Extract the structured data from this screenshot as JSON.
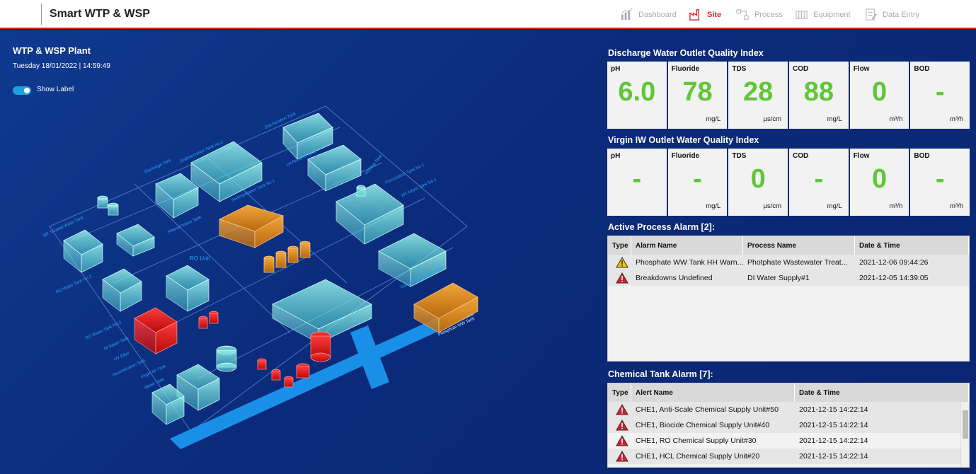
{
  "app": {
    "title": "Smart WTP & WSP"
  },
  "nav": [
    {
      "label": "Dashboard",
      "icon": "chart-icon",
      "active": false
    },
    {
      "label": "Site",
      "icon": "factory-icon",
      "active": true
    },
    {
      "label": "Process",
      "icon": "process-icon",
      "active": false
    },
    {
      "label": "Equipment",
      "icon": "equipment-icon",
      "active": false
    },
    {
      "label": "Data Entry",
      "icon": "data-entry-icon",
      "active": false
    }
  ],
  "plant": {
    "title": "WTP & WSP Plant",
    "datetime": "Tuesday 18/01/2022 | 14:59:49",
    "show_label": "Show Label",
    "show_label_on": true,
    "labels": {
      "t1": "2nd Aeration Tank",
      "t2": "Sedimentation Tank No.2",
      "t3": "1st Aeration Tank",
      "t4": "Discharge Tank",
      "t5": "Holding Tank",
      "t6": "Flocculation Tank No.1",
      "t7": "pH Adjust Tank No.1",
      "t8": "MF Treated Water Tank",
      "t9": "RO Unit",
      "t10": "RO Water Tank No.1",
      "t11": "General Batch WW Tank",
      "t12": "RO Water Tank No.2",
      "t13": "DI Water Tank",
      "t14": "UV Filter",
      "t15": "Neutralization Tank",
      "t16": "Virgin IW Tank",
      "t17": "Water Tank",
      "t18": "Phosphate WW Tank",
      "t19": "Filtered Water Tank",
      "t20": "Sedimentation Tank No.1"
    }
  },
  "discharge": {
    "title": "Discharge Water Outlet Quality Index",
    "items": [
      {
        "label": "pH",
        "value": "6.0",
        "unit": ""
      },
      {
        "label": "Fluoride",
        "value": "78",
        "unit": "mg/L"
      },
      {
        "label": "TDS",
        "value": "28",
        "unit": "µs/cm"
      },
      {
        "label": "COD",
        "value": "88",
        "unit": "mg/L"
      },
      {
        "label": "Flow",
        "value": "0",
        "unit": "m³/h"
      },
      {
        "label": "BOD",
        "value": "-",
        "unit": "m³/h"
      }
    ]
  },
  "virgin": {
    "title": "Virgin IW Outlet Water Quality Index",
    "items": [
      {
        "label": "pH",
        "value": "-",
        "unit": ""
      },
      {
        "label": "Fluoride",
        "value": "-",
        "unit": "mg/L"
      },
      {
        "label": "TDS",
        "value": "0",
        "unit": "µs/cm"
      },
      {
        "label": "COD",
        "value": "-",
        "unit": "mg/L"
      },
      {
        "label": "Flow",
        "value": "0",
        "unit": "m³/h"
      },
      {
        "label": "BOD",
        "value": "-",
        "unit": "m³/h"
      }
    ]
  },
  "process_alarm": {
    "title": "Active Process Alarm [2]:",
    "headers": [
      "Type",
      "Alarm Name",
      "Process Name",
      "Date & Time"
    ],
    "rows": [
      {
        "type": "warning-icon",
        "name": "Phosphate WW Tank HH Warn...",
        "process": "Photphate Wastewater Treat...",
        "time": "2021-12-06 09:44:26"
      },
      {
        "type": "alarm-icon",
        "name": "Breakdowns Undefined",
        "process": "DI Water Supply#1",
        "time": "2021-12-05 14:39:05"
      }
    ]
  },
  "chem_alarm": {
    "title": "Chemical Tank Alarm [7]:",
    "headers": [
      "Type",
      "Alert Name",
      "Date & Time"
    ],
    "rows": [
      {
        "type": "alarm-icon",
        "name": "CHE1, Anti-Scale Chemical Supply Unit#50",
        "time": "2021-12-15 14:22:14"
      },
      {
        "type": "alarm-icon",
        "name": "CHE1, Biocide Chemical Supply Unit#40",
        "time": "2021-12-15 14:22:14"
      },
      {
        "type": "alarm-icon",
        "name": "CHE1, RO Chemical Supply Unit#30",
        "time": "2021-12-15 14:22:14"
      },
      {
        "type": "alarm-icon",
        "name": "CHE1, HCL Chemical Supply Unit#20",
        "time": "2021-12-15 14:22:14"
      }
    ]
  },
  "colors": {
    "accent": "#d8232a",
    "value_green": "#5fc735",
    "tank_cyan": "#7fe6e0",
    "tank_orange": "#d98a1f",
    "tank_red": "#e01818",
    "water_blue": "#1a8fe8"
  }
}
